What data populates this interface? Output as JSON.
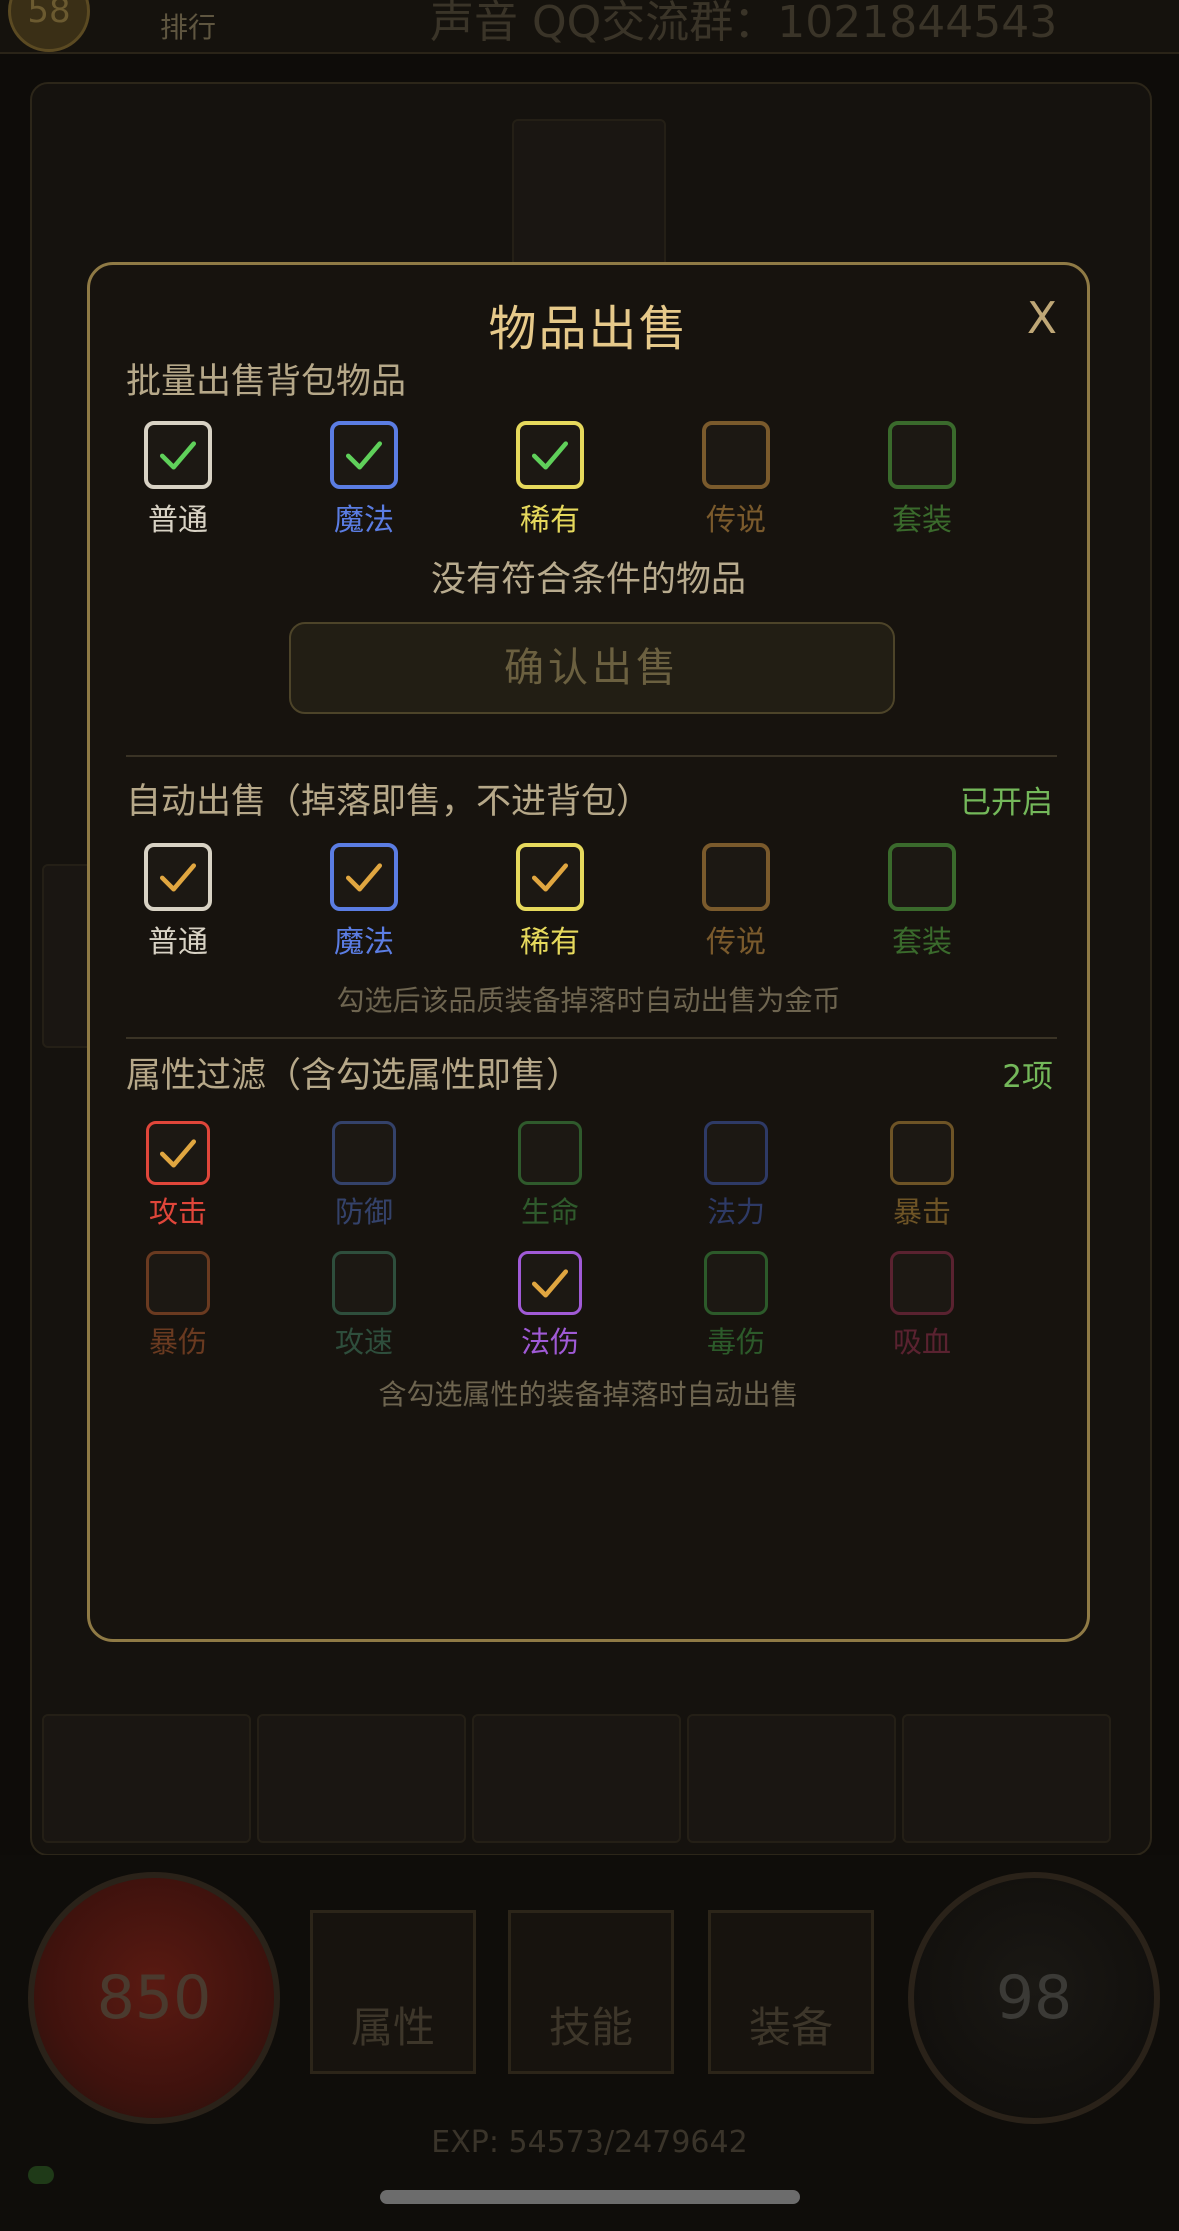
{
  "background": {
    "level": "58",
    "rank_label": "排行",
    "qq_group": "声音 QQ交流群：1021844543",
    "hp": "850",
    "mp": "98",
    "hud_buttons": [
      "属性",
      "技能",
      "装备"
    ],
    "exp": "EXP: 54573/2479642"
  },
  "modal": {
    "title": "物品出售",
    "close": "X",
    "batch": {
      "title": "批量出售背包物品",
      "options": [
        {
          "label": "普通",
          "checked": true,
          "color": "#d8d2c4",
          "check_color": "#5fd05a"
        },
        {
          "label": "魔法",
          "checked": true,
          "color": "#5b7de3",
          "check_color": "#5fd05a"
        },
        {
          "label": "稀有",
          "checked": true,
          "color": "#e6d95c",
          "check_color": "#5fd05a"
        },
        {
          "label": "传说",
          "checked": false,
          "color": "#7a5a2c",
          "check_color": "#5fd05a"
        },
        {
          "label": "套装",
          "checked": false,
          "color": "#3a6a2c",
          "check_color": "#5fd05a"
        }
      ],
      "message": "没有符合条件的物品",
      "confirm": "确认出售"
    },
    "auto_sell": {
      "title": "自动出售（掉落即售，不进背包）",
      "status": "已开启",
      "options": [
        {
          "label": "普通",
          "checked": true,
          "color": "#d8d2c4",
          "check_color": "#e0a640"
        },
        {
          "label": "魔法",
          "checked": true,
          "color": "#5b7de3",
          "check_color": "#e0a640"
        },
        {
          "label": "稀有",
          "checked": true,
          "color": "#e6d95c",
          "check_color": "#e0a640"
        },
        {
          "label": "传说",
          "checked": false,
          "color": "#7a5a2c",
          "check_color": "#e0a640"
        },
        {
          "label": "套装",
          "checked": false,
          "color": "#3a6a2c",
          "check_color": "#e0a640"
        }
      ],
      "hint": "勾选后该品质装备掉落时自动出售为金币"
    },
    "attr_filter": {
      "title": "属性过滤（含勾选属性即售）",
      "status": "2项",
      "options": [
        {
          "label": "攻击",
          "checked": true,
          "color": "#e0463a",
          "check_color": "#e0a640"
        },
        {
          "label": "防御",
          "checked": false,
          "color": "#34426a",
          "check_color": "#e0a640"
        },
        {
          "label": "生命",
          "checked": false,
          "color": "#2f5a2c",
          "check_color": "#e0a640"
        },
        {
          "label": "法力",
          "checked": false,
          "color": "#2e3a66",
          "check_color": "#e0a640"
        },
        {
          "label": "暴击",
          "checked": false,
          "color": "#6e5426",
          "check_color": "#e0a640"
        },
        {
          "label": "暴伤",
          "checked": false,
          "color": "#6a3a20",
          "check_color": "#e0a640"
        },
        {
          "label": "攻速",
          "checked": false,
          "color": "#2e4e3c",
          "check_color": "#e0a640"
        },
        {
          "label": "法伤",
          "checked": true,
          "color": "#a05ad6",
          "check_color": "#e0a640"
        },
        {
          "label": "毒伤",
          "checked": false,
          "color": "#2c5a2a",
          "check_color": "#e0a640"
        },
        {
          "label": "吸血",
          "checked": false,
          "color": "#5a2230",
          "check_color": "#e0a640"
        }
      ],
      "hint": "含勾选属性的装备掉落时自动出售"
    }
  }
}
